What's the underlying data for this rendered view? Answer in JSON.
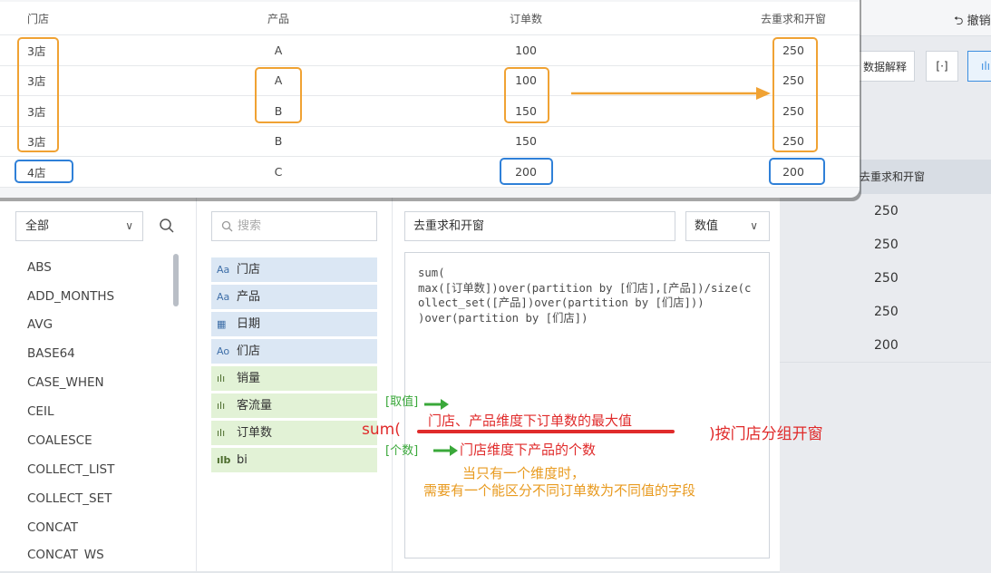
{
  "popup_table": {
    "headers": [
      "门店",
      "产品",
      "订单数",
      "去重求和开窗"
    ],
    "rows": [
      [
        "3店",
        "A",
        "100",
        "250"
      ],
      [
        "3店",
        "A",
        "100",
        "250"
      ],
      [
        "3店",
        "B",
        "150",
        "250"
      ],
      [
        "3店",
        "B",
        "150",
        "250"
      ],
      [
        "4店",
        "C",
        "200",
        "200"
      ]
    ]
  },
  "background": {
    "undo_label": "撤销",
    "toolbar_btn_label": "数据解释",
    "table_header": "去重求和开窗",
    "table_values": [
      "250",
      "250",
      "250",
      "250",
      "200"
    ]
  },
  "functions": {
    "category": "全部",
    "items": [
      "ABS",
      "ADD_MONTHS",
      "AVG",
      "BASE64",
      "CASE_WHEN",
      "CEIL",
      "COALESCE",
      "COLLECT_LIST",
      "COLLECT_SET",
      "CONCAT",
      "CONCAT_WS"
    ]
  },
  "fields": {
    "search_placeholder": "搜索",
    "items": [
      {
        "icon": "Aa",
        "name": "门店",
        "kind": "dimension"
      },
      {
        "icon": "Aa",
        "name": "产品",
        "kind": "dimension"
      },
      {
        "icon": "calendar",
        "name": "日期",
        "kind": "dimension"
      },
      {
        "icon": "Ao",
        "name": "们店",
        "kind": "dimension"
      },
      {
        "icon": "bar",
        "name": "销量",
        "kind": "measure"
      },
      {
        "icon": "bar",
        "name": "客流量",
        "kind": "measure"
      },
      {
        "icon": "bar",
        "name": "订单数",
        "kind": "measure"
      },
      {
        "icon": "bar-b",
        "name": "bi",
        "kind": "measure"
      }
    ]
  },
  "editor": {
    "name": "去重求和开窗",
    "type": "数值",
    "formula_lines": [
      "sum(",
      "max([订单数])over(partition by [们店],[产品])/size(collect_set([产品])over(partition by [们店]))",
      ")over(partition by [们店])"
    ]
  },
  "annotations": {
    "sum_open": "sum(",
    "close_text": ")按门店分组开窗",
    "take_label": "[取值]",
    "max_text": "门店、产品维度下订单数的最大值",
    "count_label": "[个数]",
    "count_text": "门店维度下产品的个数",
    "note_line1": "当只有一个维度时，",
    "note_line2": "需要有一个能区分不同订单数为不同值的字段"
  },
  "colors": {
    "highlight_orange": "#f0a233",
    "highlight_blue": "#2f80d8",
    "annotation_red": "#e02b2b",
    "annotation_green": "#3aa83a",
    "annotation_orange": "#e89a1f",
    "dimension_bg": "#dbe7f4",
    "measure_bg": "#e2f2d6"
  }
}
